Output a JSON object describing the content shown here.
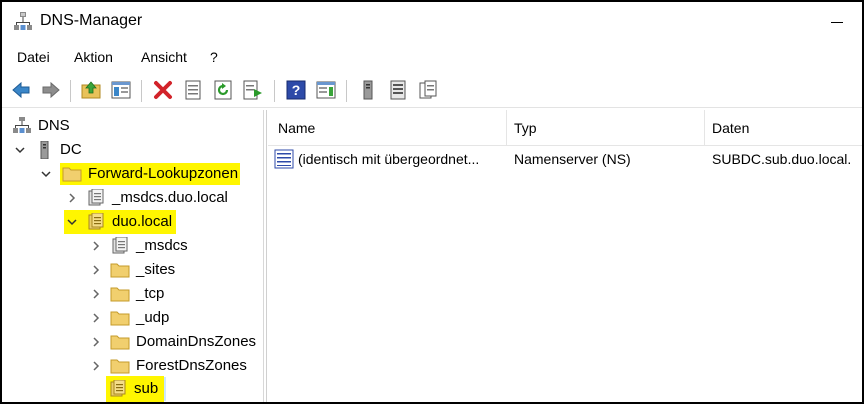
{
  "window": {
    "title": "DNS-Manager"
  },
  "menu": {
    "items": [
      "Datei",
      "Aktion",
      "Ansicht",
      "?"
    ]
  },
  "toolbar": {
    "buttons": [
      "back-arrow",
      "forward-arrow",
      "up-folder",
      "show-hide-console-tree",
      "delete",
      "properties",
      "refresh",
      "export-list",
      "help",
      "show-action-pane",
      "server",
      "list",
      "records"
    ]
  },
  "tree": {
    "items": [
      {
        "label": "DNS",
        "icon": "dns-icon",
        "expanded": null
      },
      {
        "label": "DC",
        "icon": "server-icon",
        "expanded": true
      },
      {
        "label": "Forward-Lookupzonen",
        "icon": "folder-icon",
        "expanded": true,
        "highlight": true
      },
      {
        "label": "_msdcs.duo.local",
        "icon": "zone-icon",
        "expanded": false
      },
      {
        "label": "duo.local",
        "icon": "zone-icon",
        "expanded": true,
        "highlight": true
      },
      {
        "label": "_msdcs",
        "icon": "zone-icon",
        "expanded": false
      },
      {
        "label": "_sites",
        "icon": "folder-icon",
        "expanded": false
      },
      {
        "label": "_tcp",
        "icon": "folder-icon",
        "expanded": false
      },
      {
        "label": "_udp",
        "icon": "folder-icon",
        "expanded": false
      },
      {
        "label": "DomainDnsZones",
        "icon": "folder-icon",
        "expanded": false
      },
      {
        "label": "ForestDnsZones",
        "icon": "folder-icon",
        "expanded": false
      },
      {
        "label": "sub",
        "icon": "zone-icon",
        "expanded": null,
        "highlight": true,
        "selected": true
      }
    ]
  },
  "list": {
    "columns": [
      "Name",
      "Typ",
      "Daten"
    ],
    "rows": [
      {
        "name": "(identisch mit übergeordnet...",
        "type": "Namenserver (NS)",
        "data": "SUBDC.sub.duo.local."
      }
    ]
  },
  "colors": {
    "highlight": "#fff600",
    "selection": "#cce8ff"
  }
}
